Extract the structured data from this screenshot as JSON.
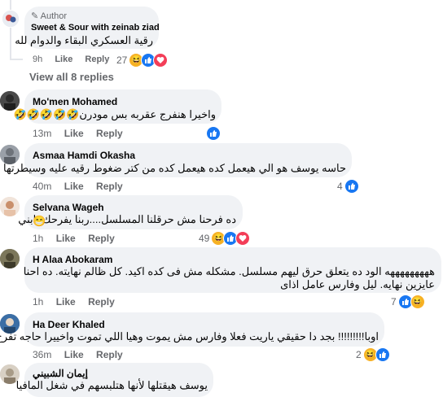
{
  "comments": [
    {
      "author": "Sweet & Sour with zeinab ziad",
      "badge": "Author",
      "text": "رقية العسكري البقاء والدوام لله",
      "time": "9h",
      "like": "Like",
      "reply": "Reply",
      "reactions_count": "27",
      "reactions": [
        "haha-icon",
        "like-icon",
        "love-icon"
      ]
    },
    {
      "author": "Mo'men Mohamed",
      "text": "واخيرا هنفرج عقربه بس مودرن🤣🤣🤣🤣🤣",
      "time": "13m",
      "like": "Like",
      "reply": "Reply",
      "reactions_count": "",
      "reactions": [
        "like-icon"
      ]
    },
    {
      "author": "Asmaa Hamdi Okasha",
      "text": "حاسه يوسف هو الي هيعمل كده هيعمل كده من كتر ضغوط رقيه عليه وسيطرتها",
      "time": "40m",
      "like": "Like",
      "reply": "Reply",
      "reactions_count": "4",
      "reactions": [
        "like-icon"
      ]
    },
    {
      "author": "Selvana Wageh",
      "text_line1": "ده فرحنا مش حرقلنا المسلسل....ربنا يفرحك يابني",
      "text_line2": "😁",
      "time": "1h",
      "like": "Like",
      "reply": "Reply",
      "reactions_count": "49",
      "reactions": [
        "haha-icon",
        "like-icon",
        "love-icon"
      ]
    },
    {
      "author": "H Alaa Abokaram",
      "text_line1": "هههههههههه الود ده يتعلق حرق ليهم مسلسل. مشكله مش فى كده اكيد. كل ظالم نهايته. ده احنا",
      "text_line2": "عايزين نهايه. ليل وفارس عامل اذاى",
      "time": "1h",
      "like": "Like",
      "reply": "Reply",
      "reactions_count": "7",
      "reactions": [
        "like-icon",
        "haha-icon"
      ]
    },
    {
      "author": "Ha Deer Khaled",
      "text": "اوبا!!!!!!!!! بجد دا حقيقي ياريت فعلا وفارس مش يموت وهيا اللي تموت واخييرا حاجه تفرح",
      "time": "36m",
      "like": "Like",
      "reply": "Reply",
      "reactions_count": "2",
      "reactions": [
        "haha-icon",
        "like-icon"
      ]
    },
    {
      "author": "إيمان الشبيني",
      "text": "يوسف هيقتلها لأنها هتلبسهم في شغل المافيا"
    }
  ],
  "view_replies": "View all 8 replies",
  "colors": {
    "like": "#1877f2",
    "haha": "#f7b125",
    "love": "#f33e58",
    "bubble": "#f0f2f5",
    "meta": "#65676b"
  }
}
